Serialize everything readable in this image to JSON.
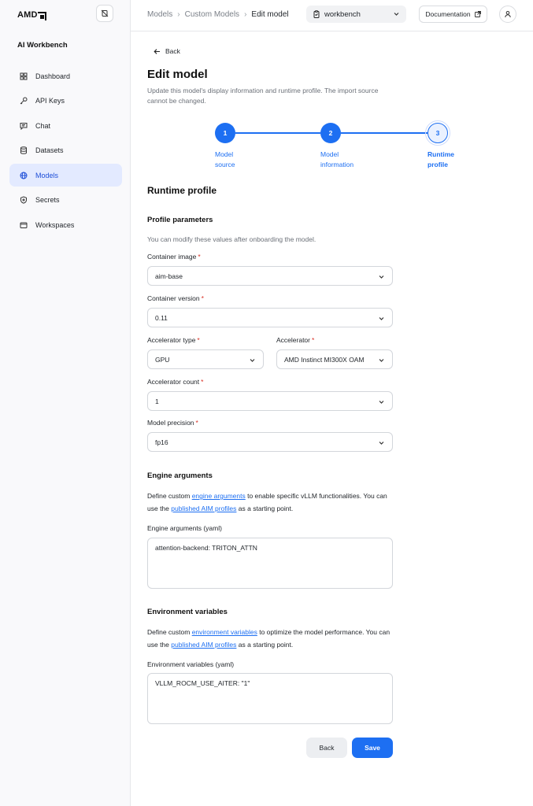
{
  "brand": {
    "logo_text": "AMD"
  },
  "app": {
    "title": "AI Workbench"
  },
  "sidebar": {
    "items": [
      {
        "label": "Dashboard",
        "icon": "dashboard-icon",
        "active": false
      },
      {
        "label": "API Keys",
        "icon": "key-icon",
        "active": false
      },
      {
        "label": "Chat",
        "icon": "chat-icon",
        "active": false
      },
      {
        "label": "Datasets",
        "icon": "database-icon",
        "active": false
      },
      {
        "label": "Models",
        "icon": "globe-icon",
        "active": true
      },
      {
        "label": "Secrets",
        "icon": "shield-icon",
        "active": false
      },
      {
        "label": "Workspaces",
        "icon": "workspace-icon",
        "active": false
      }
    ]
  },
  "header": {
    "breadcrumb": [
      "Models",
      "Custom Models",
      "Edit model"
    ],
    "workspace": "workbench",
    "documentation_label": "Documentation"
  },
  "page": {
    "back_label": "Back",
    "title": "Edit model",
    "description": "Update this model's display information and runtime profile. The import source cannot be changed."
  },
  "stepper": {
    "steps": [
      {
        "number": "1",
        "label_line1": "Model",
        "label_line2": "source",
        "state": "done"
      },
      {
        "number": "2",
        "label_line1": "Model",
        "label_line2": "information",
        "state": "done"
      },
      {
        "number": "3",
        "label_line1": "Runtime",
        "label_line2": "profile",
        "state": "current"
      }
    ]
  },
  "runtime_profile": {
    "title": "Runtime profile",
    "profile_parameters": {
      "title": "Profile parameters",
      "help": "You can modify these values after onboarding the model.",
      "container_image": {
        "label": "Container image",
        "value": "aim-base"
      },
      "container_version": {
        "label": "Container version",
        "value": "0.11"
      },
      "accelerator_type": {
        "label": "Accelerator type",
        "value": "GPU"
      },
      "accelerator": {
        "label": "Accelerator",
        "value": "AMD Instinct MI300X OAM"
      },
      "accelerator_count": {
        "label": "Accelerator count",
        "value": "1"
      },
      "model_precision": {
        "label": "Model precision",
        "value": "fp16"
      },
      "required_mark": "*"
    },
    "engine_arguments": {
      "title": "Engine arguments",
      "text_before_link": "Define custom ",
      "link1": "engine arguments",
      "text_middle": " to enable specific vLLM functionalities. You can use the ",
      "link2": "published AIM profiles",
      "text_after": " as a starting point.",
      "field_label": "Engine arguments (yaml)",
      "value": "attention-backend: TRITON_ATTN"
    },
    "environment_variables": {
      "title": "Environment variables",
      "text_before_link": "Define custom ",
      "link1": "environment variables",
      "text_middle": " to optimize the model performance. You can use the ",
      "link2": "published AIM profiles",
      "text_after": " as a starting point.",
      "field_label": "Environment variables (yaml)",
      "value": "VLLM_ROCM_USE_AITER: \"1\""
    }
  },
  "actions": {
    "back_label": "Back",
    "save_label": "Save"
  },
  "colors": {
    "accent": "#1d6ff2",
    "active_nav_bg": "#e3eaff",
    "required": "#d93025"
  }
}
